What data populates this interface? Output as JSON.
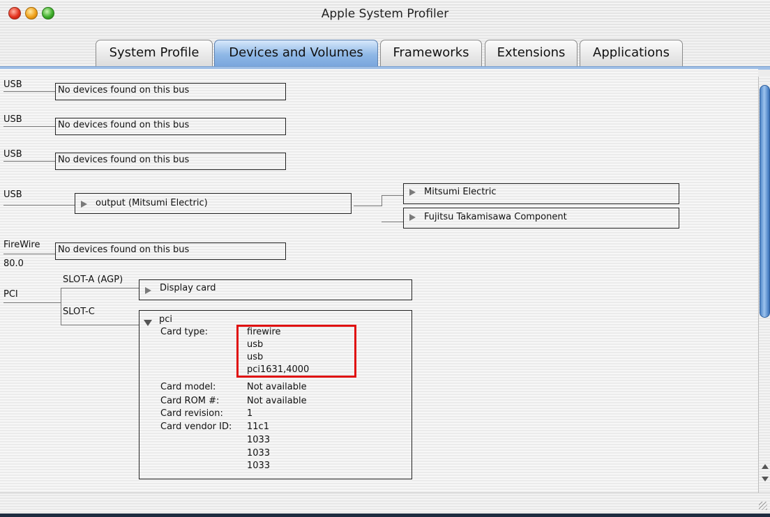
{
  "window": {
    "title": "Apple System Profiler"
  },
  "tabs": [
    {
      "label": "System Profile",
      "active": false
    },
    {
      "label": "Devices and Volumes",
      "active": true
    },
    {
      "label": "Frameworks",
      "active": false
    },
    {
      "label": "Extensions",
      "active": false
    },
    {
      "label": "Applications",
      "active": false
    }
  ],
  "buses": {
    "usb1": {
      "label": "USB",
      "status": "No devices found on this bus"
    },
    "usb2": {
      "label": "USB",
      "status": "No devices found on this bus"
    },
    "usb3": {
      "label": "USB",
      "status": "No devices found on this bus"
    },
    "usb4": {
      "label": "USB",
      "hub": "output (Mitsumi Electric)",
      "children": [
        "Mitsumi Electric",
        "Fujitsu Takamisawa Component"
      ]
    },
    "firewire": {
      "label": "FireWire",
      "sublabel": "80.0",
      "status": "No devices found on this bus"
    },
    "pci": {
      "label": "PCI",
      "slots": [
        {
          "slot": "SLOT-A (AGP)",
          "device": "Display card"
        },
        {
          "slot": "SLOT-C",
          "device": "pci"
        }
      ],
      "details": {
        "card_type_label": "Card type:",
        "card_type": [
          "firewire",
          "usb",
          "usb",
          "pci1631,4000"
        ],
        "card_model_label": "Card model:",
        "card_model": "Not available",
        "card_rom_label": "Card ROM #:",
        "card_rom": "Not available",
        "card_revision_label": "Card revision:",
        "card_revision": "1",
        "card_vendor_label": "Card vendor ID:",
        "card_vendor": [
          "11c1",
          "1033",
          "1033",
          "1033"
        ]
      }
    }
  },
  "colors": {
    "highlight": "#e01010",
    "active_tab": "#8fb8e6",
    "scroll_thumb": "#4f86c8"
  }
}
